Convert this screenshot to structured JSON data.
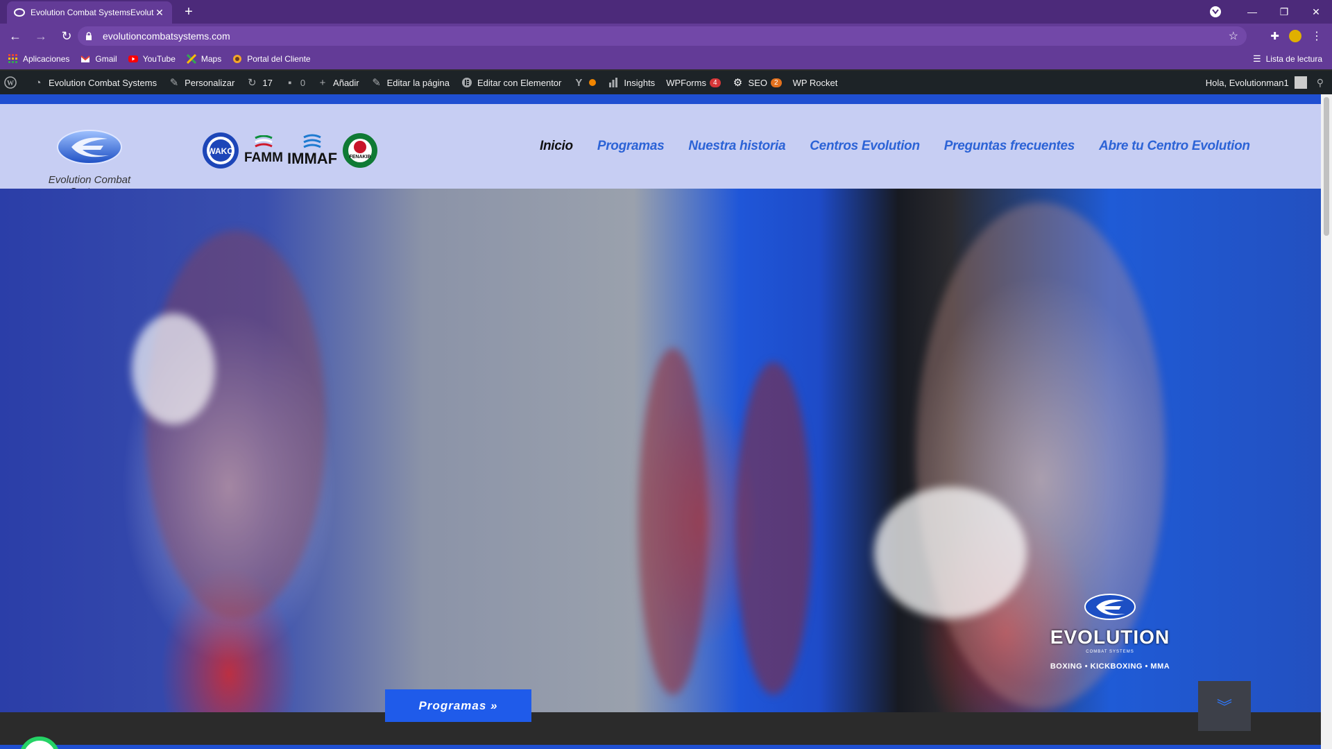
{
  "browser": {
    "tab_title": "Evolution Combat SystemsEvolut",
    "url": "evolutioncombatsystems.com",
    "bookmarks": [
      {
        "label": "Aplicaciones",
        "icon": "apps-grid-icon"
      },
      {
        "label": "Gmail",
        "icon": "gmail-icon"
      },
      {
        "label": "YouTube",
        "icon": "youtube-icon"
      },
      {
        "label": "Maps",
        "icon": "maps-icon"
      },
      {
        "label": "Portal del Cliente",
        "icon": "portal-icon"
      }
    ],
    "reading_list": "Lista de lectura"
  },
  "adminbar": {
    "site_name": "Evolution Combat Systems",
    "customize": "Personalizar",
    "updates": "17",
    "comments": "0",
    "add_new": "Añadir",
    "edit_page": "Editar la página",
    "elementor": "Editar con Elementor",
    "insights": "Insights",
    "wpforms": "WPForms",
    "wpforms_badge": "4",
    "seo": "SEO",
    "seo_badge": "2",
    "wp_rocket": "WP Rocket",
    "greeting": "Hola, Evolutionman1"
  },
  "site": {
    "logo_caption": "Evolution Combat Systems",
    "partners": [
      "WAKO",
      "FAMM",
      "IMMAF",
      "FENAKIB"
    ],
    "nav": [
      "Inicio",
      "Programas",
      "Nuestra historia",
      "Centros Evolution",
      "Preguntas frecuentes",
      "Abre tu Centro Evolution"
    ],
    "nav_active_index": 0
  },
  "hero": {
    "brand_name": "EVOLUTION",
    "brand_sub": "COMBAT SYSTEMS",
    "disciplines": "BOXING • KICKBOXING • MMA",
    "cta_label": "Programas »"
  },
  "colors": {
    "chrome_purple": "#633b97",
    "admin_bar": "#1d2327",
    "header_bg": "#c7cef3",
    "nav_link": "#2c63d6",
    "cta_blue": "#1f5bea"
  }
}
